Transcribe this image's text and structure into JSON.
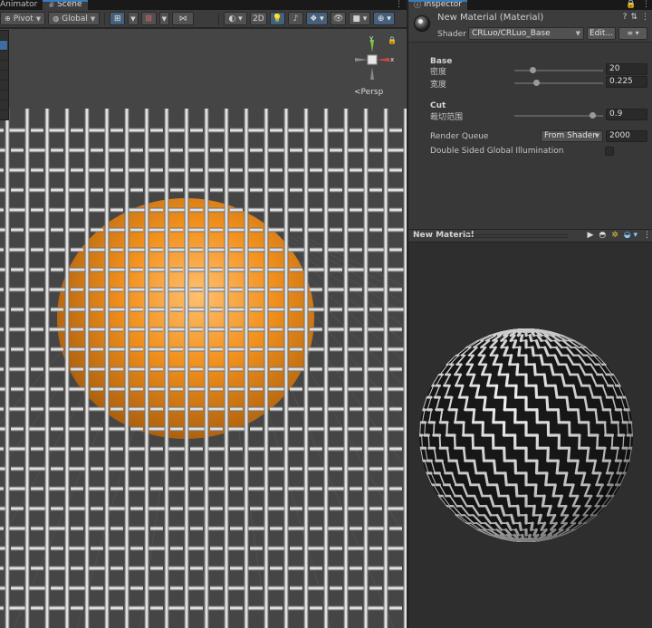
{
  "scene_tabs": [
    {
      "label": "Animator",
      "active": false
    },
    {
      "label": "Scene",
      "active": true
    }
  ],
  "scene_toolbar": {
    "pivot_label": "Pivot",
    "global_label": "Global",
    "mode_2d_label": "2D"
  },
  "viewport": {
    "persp_label": "Persp",
    "gizmo_axes": {
      "y": "y",
      "x": "x",
      "z": "z"
    }
  },
  "inspector": {
    "tab_label": "Inspector",
    "material_title": "New Material (Material)",
    "shader_label": "Shader",
    "shader_value": "CRLuo/CRLuo_Base",
    "edit_button": "Edit...",
    "list_button": "≡ ▾"
  },
  "properties": {
    "base_section": "Base",
    "density_label": "密度",
    "density_value": "20",
    "density_fraction": 0.2,
    "width_label": "宽度",
    "width_value": "0.225",
    "width_fraction": 0.24,
    "cut_section": "Cut",
    "cut_label": "裁切范围",
    "cut_value": "0.9",
    "cut_fraction": 0.88,
    "render_queue_label": "Render Queue",
    "render_queue_mode": "From Shader",
    "render_queue_value": "2000",
    "double_sided_label": "Double Sided Global Illumination",
    "double_sided_checked": false
  },
  "preview": {
    "title": "New Material"
  },
  "colors": {
    "accent": "#3a79bb",
    "sphere": "#f2901c",
    "weave": "#f2f2f2",
    "viewport_bg": "#454545"
  }
}
